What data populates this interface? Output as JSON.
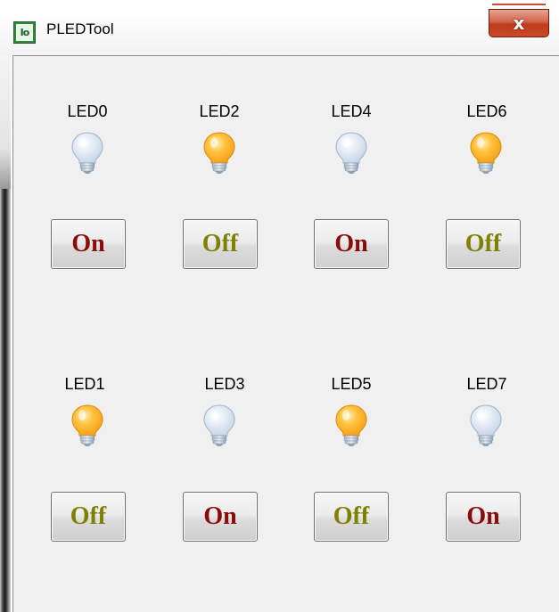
{
  "window": {
    "title": "PLEDTool",
    "close_label": "x",
    "icon": "pledtool-app-icon",
    "icon_text": "Io"
  },
  "colors": {
    "on_text": "#8b0a0a",
    "off_text": "#808000",
    "bulb_lit": "#f7a21a",
    "bulb_unlit": "#c9d7e8"
  },
  "leds": [
    {
      "label": "LED0",
      "lit": false,
      "button": "On"
    },
    {
      "label": "LED2",
      "lit": true,
      "button": "Off"
    },
    {
      "label": "LED4",
      "lit": false,
      "button": "On"
    },
    {
      "label": "LED6",
      "lit": true,
      "button": "Off"
    },
    {
      "label": "LED1",
      "lit": true,
      "button": "Off"
    },
    {
      "label": "LED3",
      "lit": false,
      "button": "On"
    },
    {
      "label": "LED5",
      "lit": true,
      "button": "Off"
    },
    {
      "label": "LED7",
      "lit": false,
      "button": "On"
    }
  ]
}
